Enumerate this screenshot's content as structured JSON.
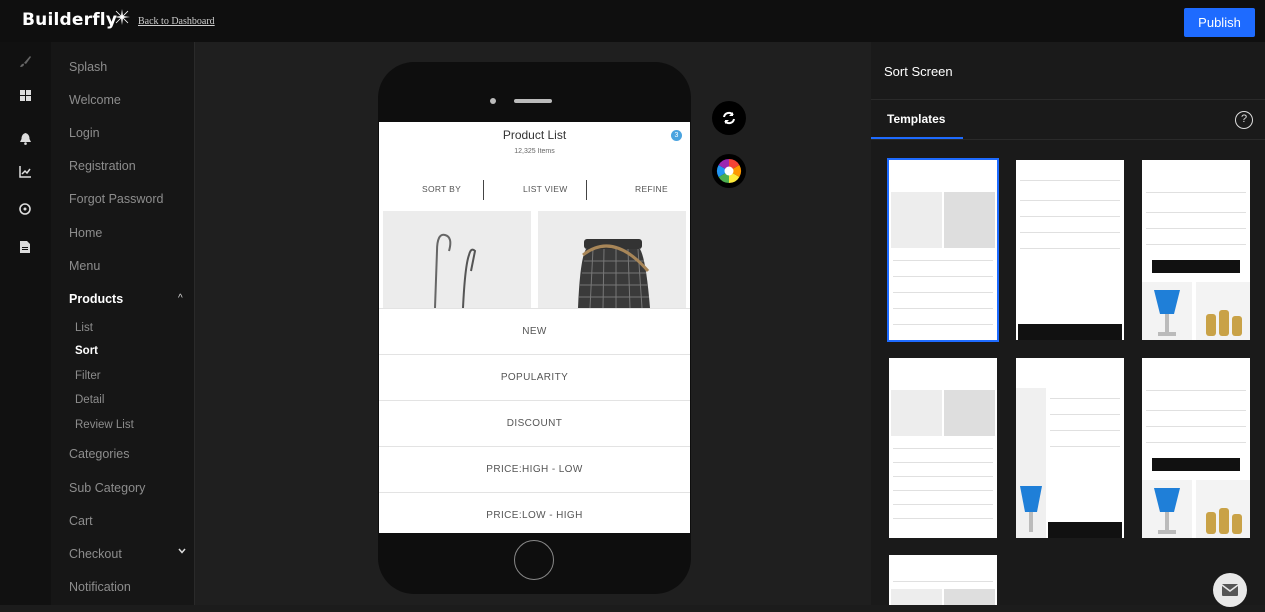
{
  "app": {
    "logo": "Builderfly",
    "back_link": "Back to Dashboard",
    "publish_label": "Publish"
  },
  "rail": {
    "icons": [
      "brush-icon",
      "dashboard-grid-icon",
      "bell-icon",
      "chart-icon",
      "settings-circle-icon",
      "document-icon"
    ]
  },
  "nav": {
    "items": {
      "splash": "Splash",
      "welcome": "Welcome",
      "login": "Login",
      "registration": "Registration",
      "forgot": "Forgot Password",
      "home": "Home",
      "menu": "Menu",
      "products": "Products",
      "categories": "Categories",
      "sub_category": "Sub Category",
      "cart": "Cart",
      "checkout": "Checkout",
      "notification": "Notification"
    },
    "products_sub": {
      "list": "List",
      "sort": "Sort",
      "filter": "Filter",
      "detail": "Detail",
      "review_list": "Review List"
    }
  },
  "preview": {
    "title": "Product List",
    "count": "12,325 Items",
    "badge": "3",
    "tabs": {
      "sort": "SORT BY",
      "view": "LIST VIEW",
      "refine": "REFINE"
    },
    "sort_options": [
      "NEW",
      "POPULARITY",
      "DISCOUNT",
      "PRICE:HIGH - LOW",
      "PRICE:LOW - HIGH"
    ]
  },
  "panel": {
    "title": "Sort Screen",
    "tab": "Templates",
    "help": "?"
  },
  "colors": {
    "accent": "#1e6bff",
    "topbar": "#0f0f0f",
    "panel": "#1a1a1a"
  }
}
